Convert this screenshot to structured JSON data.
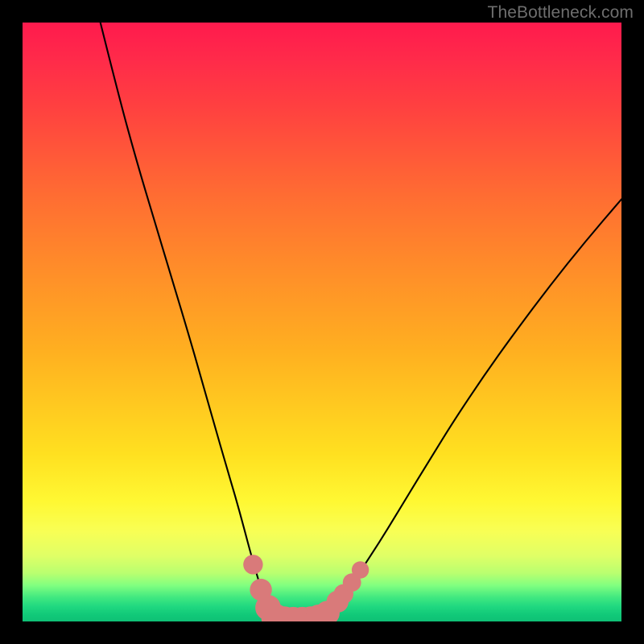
{
  "watermark": "TheBottleneck.com",
  "chart_data": {
    "type": "line",
    "title": "",
    "xlabel": "",
    "ylabel": "",
    "xlim": [
      0,
      100
    ],
    "ylim": [
      0,
      100
    ],
    "grid": false,
    "series": [
      {
        "name": "left-curve",
        "x": [
          13,
          16,
          19,
          22,
          25,
          28,
          30,
          32,
          34,
          35.5,
          37,
          38.2,
          39.3,
          40.3,
          41.2,
          42
        ],
        "y": [
          100,
          88,
          77,
          67,
          57,
          47,
          40,
          33,
          26,
          21,
          15.5,
          11,
          7.2,
          4,
          1.6,
          0.2
        ]
      },
      {
        "name": "floor",
        "x": [
          42,
          44,
          46,
          48,
          49.5
        ],
        "y": [
          0.2,
          0.0,
          0.0,
          0.0,
          0.2
        ]
      },
      {
        "name": "right-curve",
        "x": [
          49.5,
          51,
          53,
          55.5,
          58,
          61,
          64,
          68,
          72,
          77,
          82,
          88,
          94,
          100
        ],
        "y": [
          0.2,
          1.4,
          3.8,
          7,
          10.8,
          15.5,
          20.5,
          27,
          33.5,
          41,
          48,
          56,
          63.5,
          70.5
        ]
      }
    ],
    "markers": {
      "name": "floor-dots",
      "color": "#d97a7a",
      "points": [
        {
          "x": 38.5,
          "y": 9.5,
          "r": 1.1
        },
        {
          "x": 39.8,
          "y": 5.3,
          "r": 1.3
        },
        {
          "x": 41.0,
          "y": 2.3,
          "r": 1.6
        },
        {
          "x": 42.2,
          "y": 0.6,
          "r": 1.8
        },
        {
          "x": 43.7,
          "y": 0.1,
          "r": 1.9
        },
        {
          "x": 45.2,
          "y": 0.0,
          "r": 1.9
        },
        {
          "x": 46.7,
          "y": 0.0,
          "r": 1.9
        },
        {
          "x": 48.2,
          "y": 0.1,
          "r": 1.9
        },
        {
          "x": 49.5,
          "y": 0.6,
          "r": 1.7
        },
        {
          "x": 50.9,
          "y": 1.4,
          "r": 1.5
        },
        {
          "x": 52.6,
          "y": 3.3,
          "r": 1.3
        },
        {
          "x": 53.6,
          "y": 4.6,
          "r": 1.1
        },
        {
          "x": 55.0,
          "y": 6.5,
          "r": 1.0
        },
        {
          "x": 56.4,
          "y": 8.6,
          "r": 0.9
        }
      ]
    },
    "background_gradient": {
      "stops": [
        {
          "pos": 0.0,
          "color": "#ff1a4d"
        },
        {
          "pos": 0.5,
          "color": "#ffb020"
        },
        {
          "pos": 0.85,
          "color": "#f8ff55"
        },
        {
          "pos": 1.0,
          "color": "#10c878"
        }
      ]
    }
  }
}
